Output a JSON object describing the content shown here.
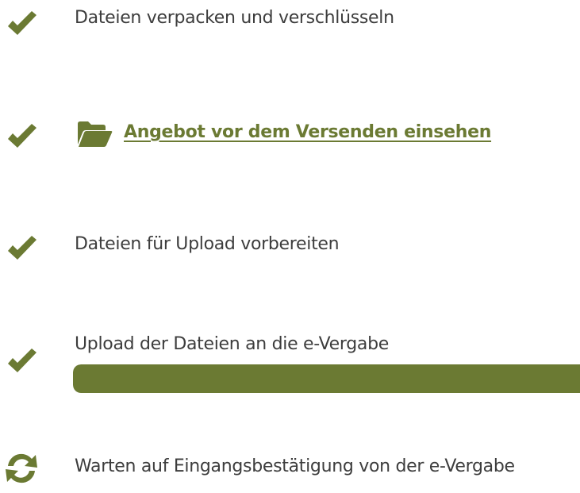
{
  "accent_color": "#6b7a33",
  "steps": [
    {
      "label": "Dateien verpacken und verschlüsseln",
      "status": "done",
      "icon": "checkmark-icon"
    },
    {
      "label": "Angebot vor dem Versenden einsehen",
      "status": "done",
      "icon": "checkmark-icon",
      "link_icon": "folder-open-icon"
    },
    {
      "label": "Dateien für Upload vorbereiten",
      "status": "done",
      "icon": "checkmark-icon"
    },
    {
      "label": "Upload der Dateien an die e-Vergabe",
      "status": "done",
      "icon": "checkmark-icon",
      "progress_percent": 100
    },
    {
      "label": "Warten auf Eingangsbestätigung von der e-Vergabe",
      "status": "in-progress",
      "icon": "refresh-icon"
    }
  ]
}
